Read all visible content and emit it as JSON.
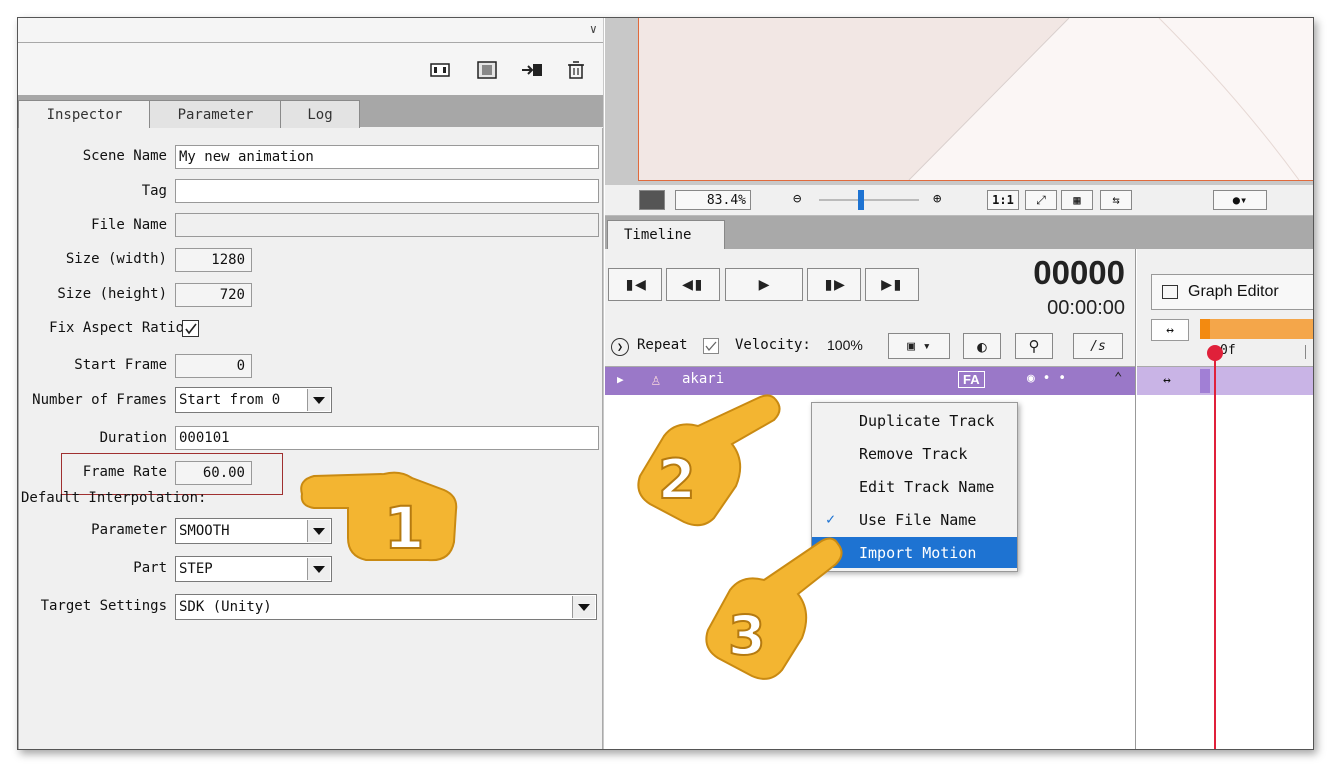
{
  "inspector": {
    "tabs": [
      "Inspector",
      "Parameter",
      "Log"
    ],
    "scene_name_label": "Scene Name",
    "scene_name_value": "My new animation",
    "tag_label": "Tag",
    "tag_value": "",
    "file_name_label": "File Name",
    "file_name_value": "",
    "size_width_label": "Size (width)",
    "size_width_value": "1280",
    "size_height_label": "Size (height)",
    "size_height_value": "720",
    "fix_aspect_label": "Fix Aspect Ratio",
    "fix_aspect_checked": true,
    "start_frame_label": "Start Frame",
    "start_frame_value": "0",
    "num_frames_label": "Number of Frames",
    "num_frames_value": "Start from 0",
    "duration_label": "Duration",
    "duration_value": "000101",
    "frame_rate_label": "Frame Rate",
    "frame_rate_value": "60.00",
    "default_interp_label": "Default Interpolation:",
    "parameter_label": "Parameter",
    "parameter_value": "SMOOTH",
    "part_label": "Part",
    "part_value": "STEP",
    "target_label": "Target Settings",
    "target_value": "SDK (Unity)"
  },
  "viewbar": {
    "zoom_value": "83.4",
    "zoom_unit": "%",
    "zoom_level": 0.42,
    "one_to_one": "1:1"
  },
  "timeline": {
    "tab_label": "Timeline",
    "frame_counter": "00000",
    "time_counter": "00:00:00",
    "repeat_label": "Repeat",
    "velocity_label": "Velocity:",
    "velocity_value": "100%",
    "fps_button": "/s",
    "graph_editor_label": "Graph Editor",
    "frame_marker": "0f",
    "track_name": "akari",
    "track_badge": "FA"
  },
  "context_menu": {
    "items": [
      "Duplicate Track",
      "Remove Track",
      "Edit Track Name",
      "Use File Name",
      "Import Motion"
    ],
    "checked_item": "Use File Name",
    "selected_item": "Import Motion"
  },
  "callouts": [
    "1",
    "2",
    "3"
  ],
  "colors": {
    "accent": "#1e73d2",
    "track": "#9a78c8",
    "playhead": "#e0203a",
    "callout": "#f3b531",
    "range": "#f4a64a"
  }
}
